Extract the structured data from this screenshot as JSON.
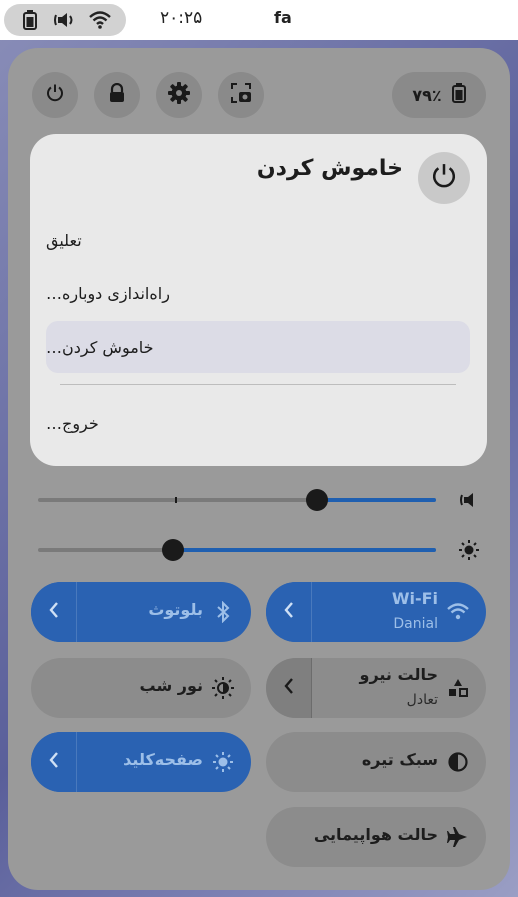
{
  "topbar": {
    "clock": "۲۰:۲۵",
    "keyboard_layout": "fa",
    "icons": [
      "battery-icon",
      "speaker-icon",
      "wifi-icon"
    ]
  },
  "header": {
    "battery_percent": "۷۹٪",
    "buttons": [
      "power-icon",
      "lock-icon",
      "settings-icon",
      "screenshot-icon"
    ]
  },
  "power_menu": {
    "title": "خاموش کردن",
    "items": [
      {
        "label": "تعلیق",
        "active": false
      },
      {
        "label": "راه‌اندازی دوباره…",
        "active": false
      },
      {
        "label": "خاموش کردن…",
        "active": true
      },
      {
        "label": "خروج…",
        "active": false
      }
    ]
  },
  "sliders": {
    "volume_level": 0.3,
    "brightness_level": 0.66,
    "volume_icon": "speaker-icon",
    "brightness_icon": "brightness-icon"
  },
  "tiles": {
    "wifi": {
      "label": "Wi-Fi",
      "sub": "Danial",
      "on": true
    },
    "bluetooth": {
      "label": "بلوتوث",
      "on": true
    },
    "power_mode": {
      "label": "حالت نیرو",
      "sub": "تعادل",
      "on": false
    },
    "night_light": {
      "label": "نور شب",
      "on": false
    },
    "dark_style": {
      "label": "سبک تیره",
      "on": false
    },
    "keyboard_brightness": {
      "label": "صفحه‌کلید",
      "on": true
    },
    "airplane": {
      "label": "حالت هواپیمایی",
      "on": false
    }
  },
  "colors": {
    "accent": "#2a62b2",
    "panel": "#9a9a9a",
    "card": "#e9e9e9"
  }
}
